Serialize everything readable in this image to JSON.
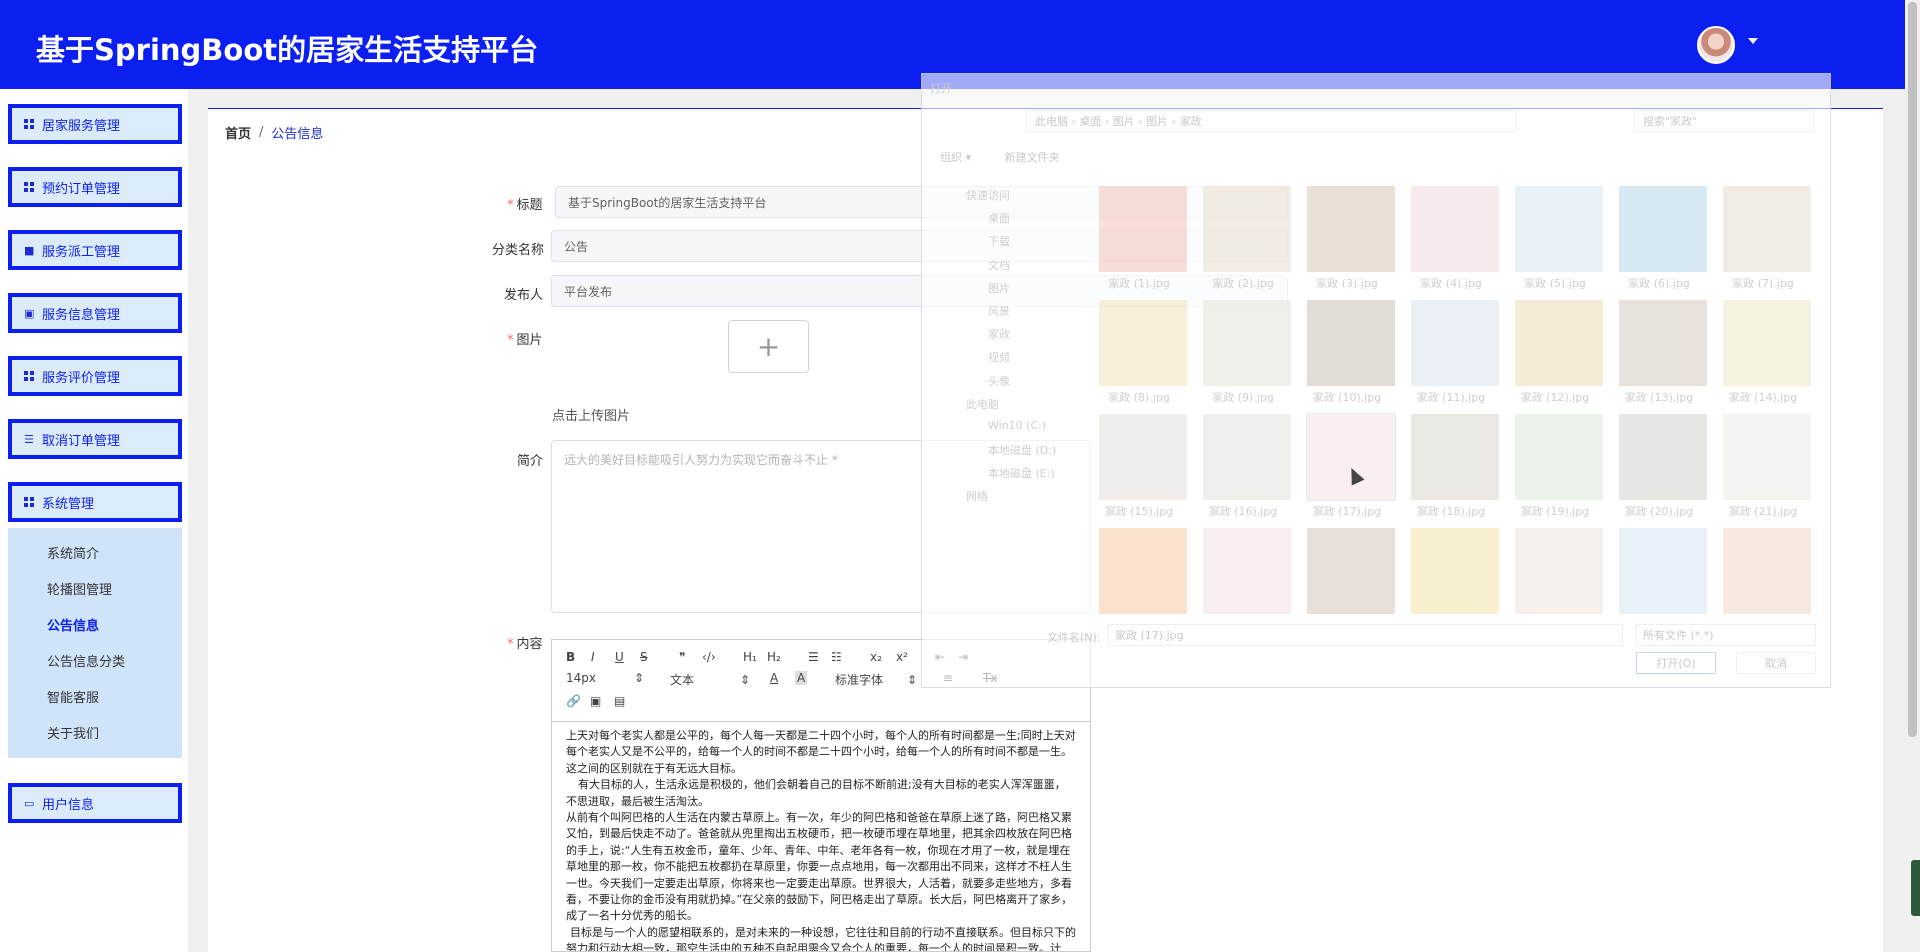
{
  "header": {
    "title": "基于SpringBoot的居家生活支持平台"
  },
  "sidebar": {
    "items": [
      {
        "label": "居家服务管理",
        "icon": "grid-icon"
      },
      {
        "label": "预约订单管理",
        "icon": "grid-icon"
      },
      {
        "label": "服务派工管理",
        "icon": "briefcase-icon"
      },
      {
        "label": "服务信息管理",
        "icon": "clipboard-icon"
      },
      {
        "label": "服务评价管理",
        "icon": "grid-icon"
      },
      {
        "label": "取消订单管理",
        "icon": "sliders-icon"
      },
      {
        "label": "系统管理",
        "icon": "grid-icon"
      },
      {
        "label": "用户信息",
        "icon": "calendar-icon"
      }
    ],
    "submenu": [
      {
        "label": "系统简介"
      },
      {
        "label": "轮播图管理"
      },
      {
        "label": "公告信息",
        "active": true
      },
      {
        "label": "公告信息分类"
      },
      {
        "label": "智能客服"
      },
      {
        "label": "关于我们"
      }
    ]
  },
  "breadcrumb": {
    "home": "首页",
    "separator": "/",
    "current": "公告信息"
  },
  "form": {
    "title_label": "标题",
    "title_value": "基于SpringBoot的居家生活支持平台",
    "category_label": "分类名称",
    "category_value": "公告",
    "publisher_label": "发布人",
    "publisher_value": "平台发布",
    "image_label": "图片",
    "upload_plus": "+",
    "upload_tip": "点击上传图片",
    "intro_label": "简介",
    "intro_placeholder": "远大的美好目标能吸引人努力为实现它而奋斗不止 *",
    "content_label": "内容"
  },
  "editor": {
    "toolbar": {
      "bold": "B",
      "italic": "I",
      "underline": "U",
      "strike": "S",
      "quote": "❞",
      "code": "‹/›",
      "h1": "H₁",
      "h2": "H₂",
      "ordered_list": "☰",
      "bullet_list": "☷",
      "sub": "x₂",
      "sup": "x²",
      "outdent": "⇤",
      "indent": "⇥",
      "size": "14px",
      "text_style": "文本",
      "font_color": "A",
      "bg_color": "A",
      "font_family": "标准字体",
      "align": "≡",
      "clear": "Tx",
      "link": "🔗",
      "image": "▣",
      "video": "▤"
    },
    "paragraphs": [
      "上天对每个老实人都是公平的，每个人每一天都是二十四个小时，每个人的所有时间都是一生;同时上天对每个老实人又是不公平的，给每一个人的时间不都是二十四个小时，给每一个人的所有时间不都是一生。这之间的区别就在于有无远大目标。",
      "有大目标的人，生活永远是积极的，他们会朝着自己的目标不断前进;没有大目标的老实人浑浑噩噩，不思进取，最后被生活淘汰。",
      "从前有个叫阿巴格的人生活在内蒙古草原上。有一次，年少的阿巴格和爸爸在草原上迷了路，阿巴格又累又怕，到最后快走不动了。爸爸就从兜里掏出五枚硬币，把一枚硬币埋在草地里，把其余四枚放在阿巴格的手上，说:“人生有五枚金币，童年、少年、青年、中年、老年各有一枚，你现在才用了一枚，就是埋在草地里的那一枚，你不能把五枚都扔在草原里，你要一点点地用，每一次都用出不同来，这样才不枉人生一世。今天我们一定要走出草原，你将来也一定要走出草原。世界很大，人活着，就要多走些地方，多看看，不要让你的金币没有用就扔掉。”在父亲的鼓励下，阿巴格走出了草原。长大后，阿巴格离开了家乡，成了一名十分优秀的船长。",
      "目标是与一个人的愿望相联系的，是对未来的一种设想，它往往和目前的行动不直接联系。但目标只下的努力和行动大相一致，那空生活中的五种不自起用需今又合个人的重要，每一个人的时间是积一致。计"
    ]
  },
  "dialog": {
    "title": "打开",
    "address": "此电脑  ›  桌面  ›  图片  ›  图片  ›  家政",
    "search_placeholder": "搜索\"家政\"",
    "toolbar": [
      "组织 ▾",
      "新建文件夹"
    ],
    "nav": [
      {
        "label": "快速访问"
      },
      {
        "label": "桌面",
        "sub": true
      },
      {
        "label": "下载",
        "sub": true
      },
      {
        "label": "文档",
        "sub": true
      },
      {
        "label": "图片",
        "sub": true
      },
      {
        "label": "风景",
        "sub": true
      },
      {
        "label": "家政",
        "sub": true
      },
      {
        "label": "视频",
        "sub": true
      },
      {
        "label": "头像",
        "sub": true
      },
      {
        "label": "此电脑"
      },
      {
        "label": "Win10 (C:)",
        "sub": true
      },
      {
        "label": "本地磁盘 (D:)",
        "sub": true
      },
      {
        "label": "本地磁盘 (E:)",
        "sub": true
      },
      {
        "label": "网络"
      }
    ],
    "files": [
      {
        "name": "家政 (1).jpg",
        "color": "#f2c1b8"
      },
      {
        "name": "家政 (2).jpg",
        "color": "#e8dccd"
      },
      {
        "name": "家政 (3).jpg",
        "color": "#d9c8b5"
      },
      {
        "name": "家政 (4).jpg",
        "color": "#f1d8d8"
      },
      {
        "name": "家政 (5).jpg",
        "color": "#d5e7ee"
      },
      {
        "name": "家政 (6).jpg",
        "color": "#b7d9ea"
      },
      {
        "name": "家政 (7).jpg",
        "color": "#e6dcd0"
      },
      {
        "name": "家政 (8).jpg",
        "color": "#f2e3b8"
      },
      {
        "name": "家政 (9).jpg",
        "color": "#dfe6d8"
      },
      {
        "name": "家政 (10).jpg",
        "color": "#c9bfb4"
      },
      {
        "name": "家政 (11).jpg",
        "color": "#dbe3ee"
      },
      {
        "name": "家政 (12).jpg",
        "color": "#eadfb6"
      },
      {
        "name": "家政 (13).jpg",
        "color": "#d6cbc1"
      },
      {
        "name": "家政 (14).jpg",
        "color": "#efe8c9"
      },
      {
        "name": "家政 (15).jpg",
        "color": "#e3ded8"
      },
      {
        "name": "家政 (16).jpg",
        "color": "#e6e2dc"
      },
      {
        "name": "家政 (17).jpg",
        "color": "#f5e3e3",
        "selected": true
      },
      {
        "name": "家政 (18).jpg",
        "color": "#ddd7cf"
      },
      {
        "name": "家政 (19).jpg",
        "color": "#dde9d9"
      },
      {
        "name": "家政 (20).jpg",
        "color": "#d6d1cc"
      },
      {
        "name": "家政 (21).jpg",
        "color": "#ecebe6"
      },
      {
        "name": "",
        "color": "#f5caa2"
      },
      {
        "name": "",
        "color": "#f3dfe3"
      },
      {
        "name": "",
        "color": "#d6c7be"
      },
      {
        "name": "",
        "color": "#f3e2a6"
      },
      {
        "name": "",
        "color": "#ede3dc"
      },
      {
        "name": "",
        "color": "#d7e6f3"
      },
      {
        "name": "",
        "color": "#f3d7c6"
      }
    ],
    "filename_label": "文件名(N):",
    "filename_value": "家政 (17).jpg",
    "filetype_value": "所有文件 (*.*)",
    "open_button": "打开(O)",
    "cancel_button": "取消"
  },
  "colors": {
    "primary": "#0a1ff0",
    "menu_bg": "#dcebfa",
    "submenu_bg": "#cfe3f9",
    "required": "#f56c6c"
  }
}
